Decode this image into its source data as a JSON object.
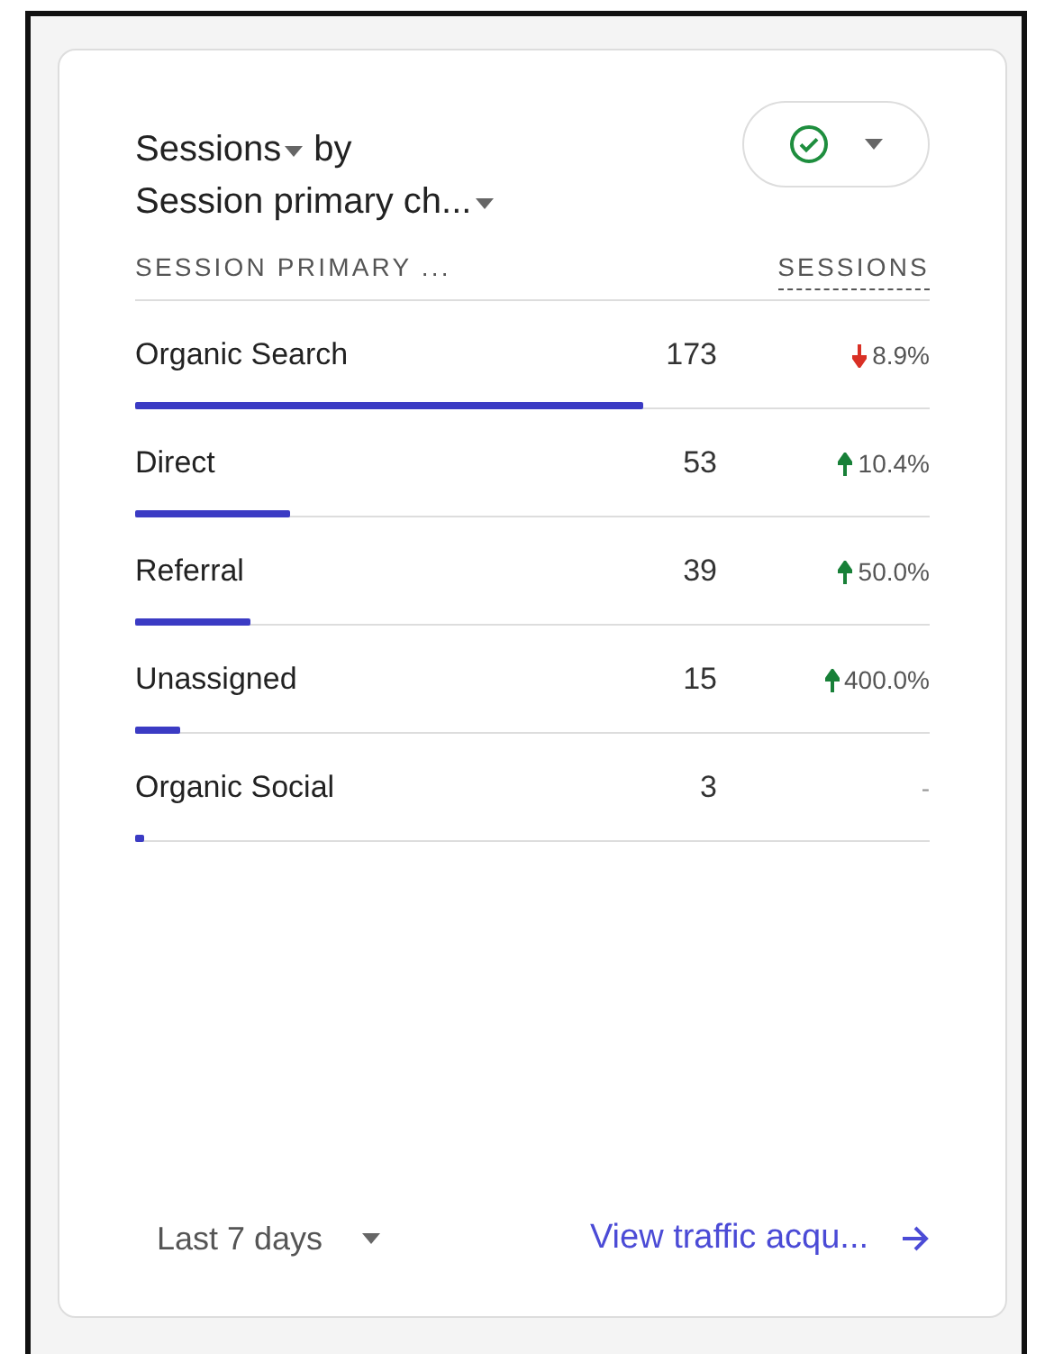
{
  "card": {
    "title_metric": "Sessions",
    "title_by": "by",
    "title_dimension": "Session primary ch...",
    "status_button": {
      "ok": true
    },
    "columns": [
      "SESSION PRIMARY ...",
      "SESSIONS"
    ],
    "rows": [
      {
        "name": "Organic Search",
        "value": "173",
        "change": "8.9%",
        "kind": "down",
        "level": 0.64
      },
      {
        "name": "Direct",
        "value": "53",
        "change": "10.4%",
        "kind": "up",
        "level": 0.196
      },
      {
        "name": "Referral",
        "value": "39",
        "change": "50.0%",
        "kind": "up",
        "level": 0.145
      },
      {
        "name": "Unassigned",
        "value": "15",
        "change": "400.0%",
        "kind": "up",
        "level": 0.056
      },
      {
        "name": "Organic Social",
        "value": "3",
        "change": "-",
        "kind": "none",
        "level": 0.011
      }
    ],
    "date_range": "Last 7 days",
    "link": "View traffic acqu..."
  }
}
